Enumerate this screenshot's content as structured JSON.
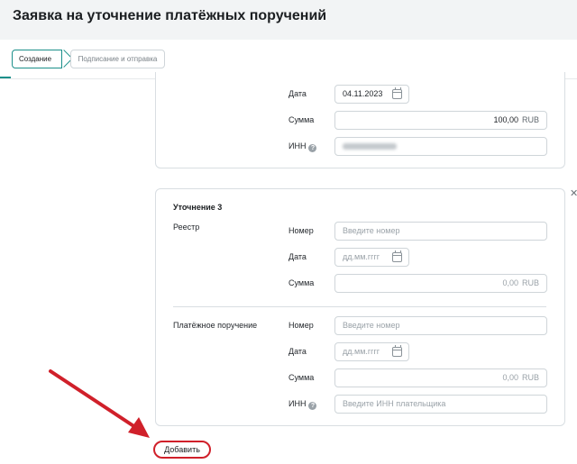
{
  "header": {
    "title": "Заявка на уточнение платёжных поручений"
  },
  "steps": {
    "active": "Создание",
    "inactive": "Подписание и отправка"
  },
  "top_card": {
    "date_label": "Дата",
    "date_value": "04.11.2023",
    "sum_label": "Сумма",
    "sum_value": "100,00",
    "currency": "RUB",
    "inn_label": "ИНН",
    "help_icon": "question-circle-icon"
  },
  "bottom_card": {
    "title": "Уточнение 3",
    "registry": {
      "section_label": "Реестр",
      "number_label": "Номер",
      "number_placeholder": "Введите номер",
      "date_label": "Дата",
      "date_placeholder": "дд.мм.гггг",
      "sum_label": "Сумма",
      "sum_value": "0,00",
      "currency": "RUB"
    },
    "payment_order": {
      "section_label": "Платёжное поручение",
      "number_label": "Номер",
      "number_placeholder": "Введите номер",
      "date_label": "Дата",
      "date_placeholder": "дд.мм.гггг",
      "sum_label": "Сумма",
      "sum_value": "0,00",
      "currency": "RUB",
      "inn_label": "ИНН",
      "inn_placeholder": "Введите ИНН плательщика"
    }
  },
  "actions": {
    "add_label": "Добавить",
    "close_glyph": "✕"
  },
  "colors": {
    "accent": "#1b8f8a",
    "annotation": "#d0202a",
    "header_bg": "#f2f4f5"
  }
}
